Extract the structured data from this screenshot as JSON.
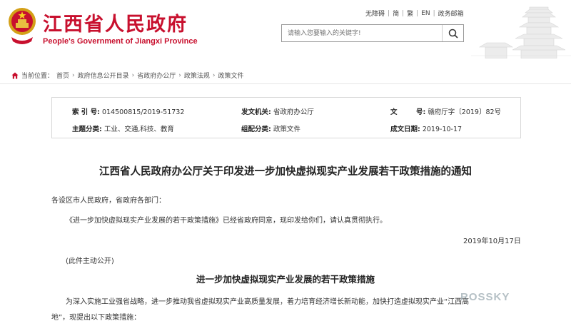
{
  "header": {
    "title": "江西省人民政府",
    "subtitle": "People's Government of Jiangxi Province",
    "nav": [
      "无障碍",
      "简",
      "繁",
      "EN",
      "政务邮箱"
    ],
    "search_placeholder": "请输入您要输入的关键字!",
    "brand_color": "#c8102e"
  },
  "breadcrumb": {
    "label": "当前位置：",
    "items": [
      "首页",
      "政府信息公开目录",
      "省政府办公厅",
      "政策法规",
      "政策文件"
    ]
  },
  "info": {
    "index_label": "索  引 号:",
    "index_value": "014500815/2019-51732",
    "org_label": "发文机关:",
    "org_value": "省政府办公厅",
    "docno_label": "文        号:",
    "docno_value": "赣府厅字〔2019〕82号",
    "topic_label": "主题分类:",
    "topic_value": "工业、交通,科技、教育",
    "cat_label": "组配分类:",
    "cat_value": "政策文件",
    "date_label": "成文日期:",
    "date_value": "2019-10-17"
  },
  "article": {
    "title": "江西省人民政府办公厅关于印发进一步加快虚拟现实产业发展若干政策措施的通知",
    "salutation": "各设区市人民政府，省政府各部门：",
    "body1": "《进一步加快虚拟现实产业发展的若干政策措施》已经省政府同意，现印发给你们，请认真贯彻执行。",
    "date": "2019年10月17日",
    "note": "(此件主动公开)",
    "subtitle": "进一步加快虚拟现实产业发展的若干政策措施",
    "body2_line1": "为深入实施工业强省战略，进一步推动我省虚拟现实产业高质量发展，着力培育经济增长新动能，加快打造虚拟现实产业“江西高",
    "body2_line2": "地”，现提出以下政策措施："
  },
  "watermark": "ROSSKY"
}
